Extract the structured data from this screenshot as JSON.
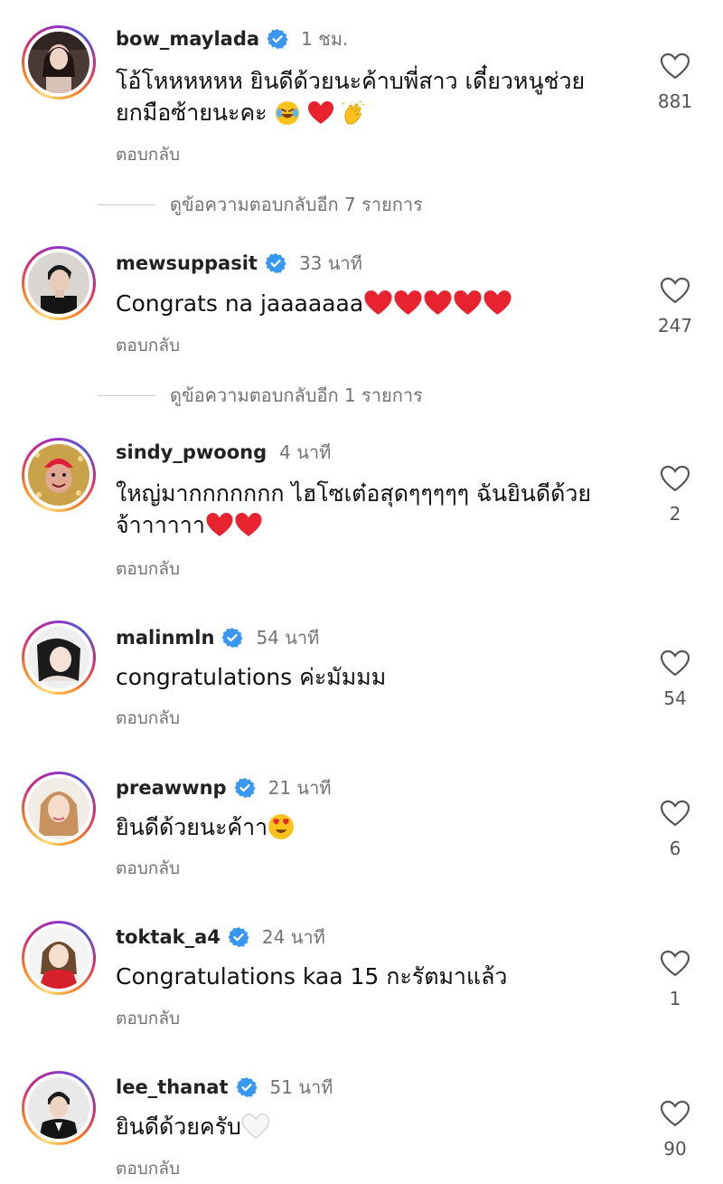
{
  "comments": [
    {
      "username": "bow_maylada",
      "verified": true,
      "time": "1 ชม.",
      "text_lines": [
        "โอ้โหหหหหห ยินดีด้วยนะค้าบพี่สาว เดี๋ยวหนูช่วย",
        "ยกมือซ้ายนะคะ"
      ],
      "emojis": [
        "laughing-tears-emoji",
        "red-heart-emoji",
        "clapping-hands-emoji"
      ],
      "reply_label": "ตอบกลับ",
      "likes": "881",
      "more_replies": "ดูข้อความตอบกลับอีก 7 รายการ"
    },
    {
      "username": "mewsuppasit",
      "verified": true,
      "time": "33 นาที",
      "text_lines": [
        "Congrats na jaaaaaaa"
      ],
      "emojis": [
        "red-heart-emoji",
        "red-heart-emoji",
        "red-heart-emoji",
        "red-heart-emoji",
        "red-heart-emoji"
      ],
      "reply_label": "ตอบกลับ",
      "likes": "247",
      "more_replies": "ดูข้อความตอบกลับอีก 1 รายการ"
    },
    {
      "username": "sindy_pwoong",
      "verified": false,
      "time": "4 นาที",
      "text_lines": [
        "ใหญ่มากกกกกกก ไฮโซเต๋อสุดๆๆๆๆๆ ฉันยินดีด้วย",
        "จ้าาาาาา"
      ],
      "emojis": [
        "red-heart-emoji",
        "red-heart-emoji"
      ],
      "reply_label": "ตอบกลับ",
      "likes": "2"
    },
    {
      "username": "malinmln",
      "verified": true,
      "time": "54 นาที",
      "text_lines": [
        "congratulations ค่ะมัมมม"
      ],
      "emojis": [],
      "reply_label": "ตอบกลับ",
      "likes": "54"
    },
    {
      "username": "preawwnp",
      "verified": true,
      "time": "21 นาที",
      "text_lines": [
        "ยินดีด้วยนะค้าา"
      ],
      "emojis": [
        "heart-eyes-emoji"
      ],
      "reply_label": "ตอบกลับ",
      "likes": "6"
    },
    {
      "username": "toktak_a4",
      "verified": true,
      "time": "24 นาที",
      "text_lines": [
        "Congratulations kaa 15 กะรัตมาแล้ว"
      ],
      "emojis": [],
      "reply_label": "ตอบกลับ",
      "likes": "1"
    },
    {
      "username": "lee_thanat",
      "verified": true,
      "time": "51 นาที",
      "text_lines": [
        "ยินดีด้วยครับ"
      ],
      "emojis": [
        "white-heart-emoji"
      ],
      "reply_label": "ตอบกลับ",
      "likes": "90"
    }
  ],
  "colors": {
    "verified_blue": "#3897f0",
    "secondary_text": "#737373",
    "heart_red": "#e0245e"
  }
}
